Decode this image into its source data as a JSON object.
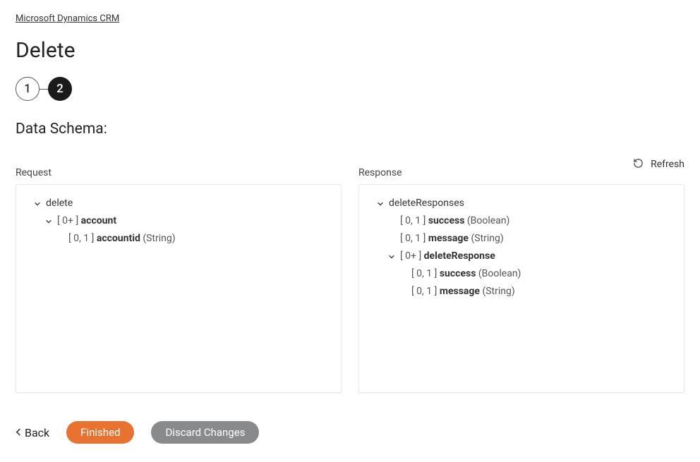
{
  "breadcrumb": "Microsoft Dynamics CRM",
  "page_title": "Delete",
  "stepper": {
    "step1": "1",
    "step2": "2"
  },
  "section_title": "Data Schema:",
  "refresh_label": "Refresh",
  "columns": {
    "request": {
      "label": "Request",
      "tree": {
        "root": "delete",
        "account": {
          "cardinality": "[ 0+ ]",
          "name": "account"
        },
        "accountid": {
          "cardinality": "[ 0, 1 ]",
          "name": "accountid",
          "type": "(String)"
        }
      }
    },
    "response": {
      "label": "Response",
      "tree": {
        "root": "deleteResponses",
        "success1": {
          "cardinality": "[ 0, 1 ]",
          "name": "success",
          "type": "(Boolean)"
        },
        "message1": {
          "cardinality": "[ 0, 1 ]",
          "name": "message",
          "type": "(String)"
        },
        "deleteResponse": {
          "cardinality": "[ 0+ ]",
          "name": "deleteResponse"
        },
        "success2": {
          "cardinality": "[ 0, 1 ]",
          "name": "success",
          "type": "(Boolean)"
        },
        "message2": {
          "cardinality": "[ 0, 1 ]",
          "name": "message",
          "type": "(String)"
        }
      }
    }
  },
  "footer": {
    "back": "Back",
    "finished": "Finished",
    "discard": "Discard Changes"
  }
}
